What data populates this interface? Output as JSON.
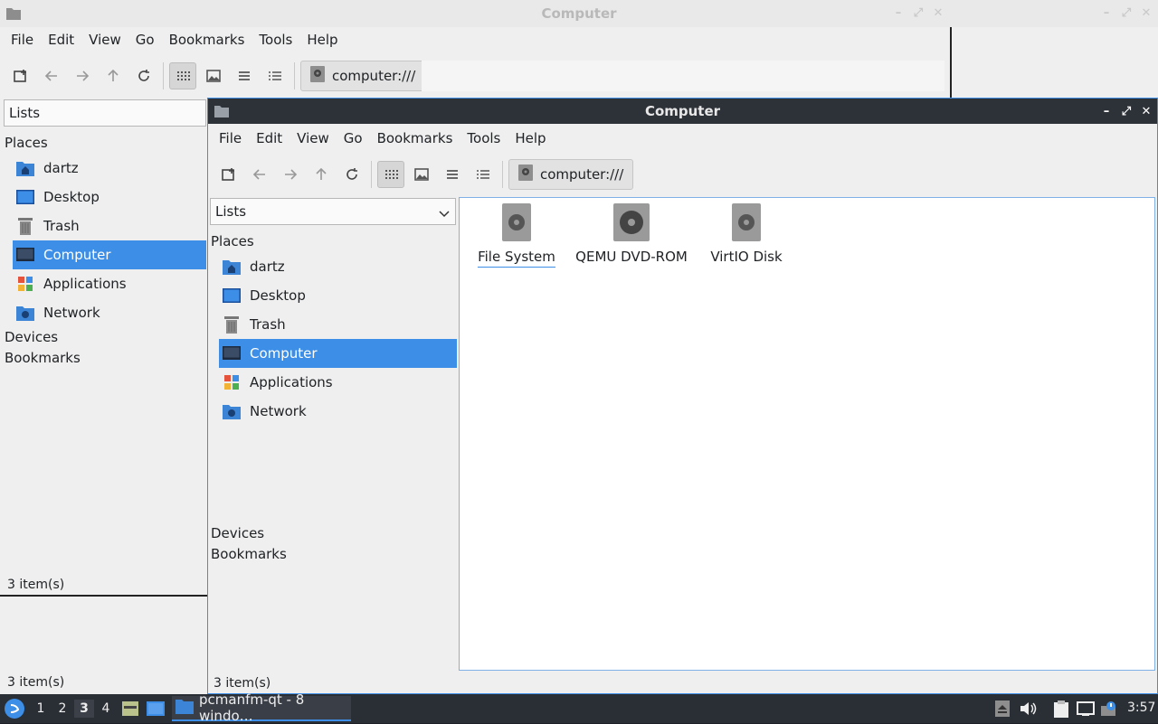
{
  "desktop": {
    "accent": "#3d8ee6"
  },
  "back_window": {
    "title": "Computer",
    "menu": [
      "File",
      "Edit",
      "View",
      "Go",
      "Bookmarks",
      "Tools",
      "Help"
    ],
    "path": "computer:///",
    "side_combo": "Lists",
    "places_header": "Places",
    "places": [
      "dartz",
      "Desktop",
      "Trash",
      "Computer",
      "Applications",
      "Network"
    ],
    "devices": "Devices",
    "bookmarks": "Bookmarks",
    "status1": "3 item(s)",
    "status2": "3 item(s)"
  },
  "front_window": {
    "title": "Computer",
    "menu": [
      "File",
      "Edit",
      "View",
      "Go",
      "Bookmarks",
      "Tools",
      "Help"
    ],
    "path": "computer:///",
    "side_combo": "Lists",
    "places_header": "Places",
    "places": [
      "dartz",
      "Desktop",
      "Trash",
      "Computer",
      "Applications",
      "Network"
    ],
    "selected_place": "Computer",
    "devices": "Devices",
    "bookmarks": "Bookmarks",
    "items": [
      "File System",
      "QEMU DVD-ROM",
      "VirtIO Disk"
    ],
    "status": "3 item(s)"
  },
  "taskbar": {
    "workspaces": [
      "1",
      "2",
      "3",
      "4"
    ],
    "current_workspace": "3",
    "task_label": "pcmanfm-qt - 8 windo…",
    "clock": "3:57"
  }
}
